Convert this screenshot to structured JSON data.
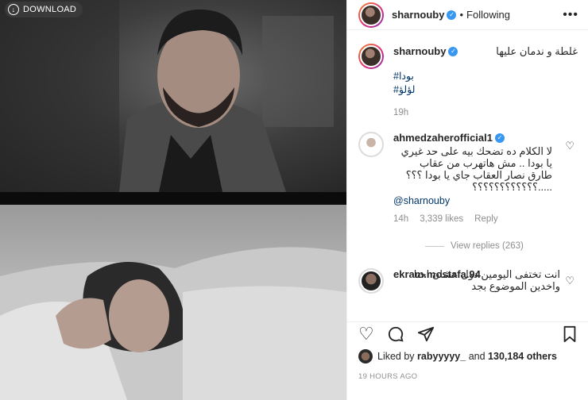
{
  "media": {
    "download_label": "DOWNLOAD"
  },
  "header": {
    "username": "sharnouby",
    "separator": "•",
    "following_label": "Following",
    "more_label": "•••"
  },
  "caption": {
    "username": "sharnouby",
    "text": "غلطة و ندمان عليها",
    "tags": [
      "#بودا",
      "#لؤلؤ"
    ],
    "time": "19h"
  },
  "comments": [
    {
      "username": "ahmedzaherofficial1",
      "text": "لا الكلام ده تضحك بيه على حد غيري يا بودا .. مش هاتهرب من عقاب طارق نصار العقاب جاي يا بودا ؟؟؟ .....؟؟؟؟؟؟؟؟؟؟؟؟",
      "mention": "@sharnouby",
      "time": "14h",
      "likes": "3,339 likes",
      "reply": "Reply",
      "view_replies": "View replies (263)"
    },
    {
      "username": "ekram.mostafa.94",
      "text": "انت تختفى اليومين دول عشان احنا واخدين الموضوع بجد"
    }
  ],
  "likes_summary": {
    "prefix": "Liked by",
    "user": "rabyyyyy_",
    "middle": "and",
    "count": "130,184 others"
  },
  "posted_ago": "19 HOURS AGO",
  "colors": {
    "verified": "#3897f0",
    "link": "#003569",
    "muted": "#8e8e8e"
  }
}
